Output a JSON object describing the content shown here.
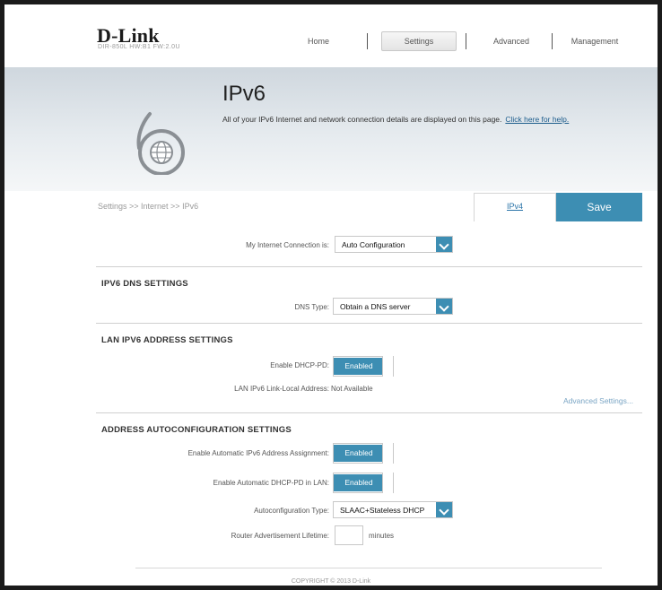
{
  "header": {
    "brand": "D-Link",
    "model_info": "DIR-850L  HW:B1  FW:2.0U",
    "nav": {
      "home": "Home",
      "settings": "Settings",
      "advanced": "Advanced",
      "management": "Management"
    }
  },
  "banner": {
    "title": "IPv6",
    "description": "All of your IPv6 Internet and network connection details are displayed on this page.",
    "help_link": "Click here for help."
  },
  "breadcrumb": "Settings >> Internet >> IPv6",
  "actions": {
    "ipv4_link": "IPv4",
    "save": "Save"
  },
  "connection": {
    "label": "My Internet Connection is:",
    "value": "Auto Configuration"
  },
  "dns": {
    "heading": "IPV6 DNS SETTINGS",
    "type_label": "DNS Type:",
    "type_value": "Obtain a DNS server"
  },
  "lan": {
    "heading": "LAN IPV6 ADDRESS SETTINGS",
    "dhcp_pd_label": "Enable DHCP-PD:",
    "dhcp_pd_value": "Enabled",
    "link_local_label": "LAN IPv6 Link-Local Address:",
    "link_local_value": "Not Available",
    "advanced_link": "Advanced Settings..."
  },
  "autoconfig": {
    "heading": "ADDRESS AUTOCONFIGURATION SETTINGS",
    "auto_assign_label": "Enable Automatic IPv6 Address Assignment:",
    "auto_assign_value": "Enabled",
    "auto_dhcp_label": "Enable Automatic DHCP-PD in LAN:",
    "auto_dhcp_value": "Enabled",
    "type_label": "Autoconfiguration Type:",
    "type_value": "SLAAC+Stateless DHCP",
    "lifetime_label": "Router Advertisement Lifetime:",
    "lifetime_value": "",
    "lifetime_unit": "minutes"
  },
  "footer": "COPYRIGHT © 2013 D-Link",
  "colors": {
    "accent": "#3d8eb3",
    "frame": "#1b1b1b"
  }
}
